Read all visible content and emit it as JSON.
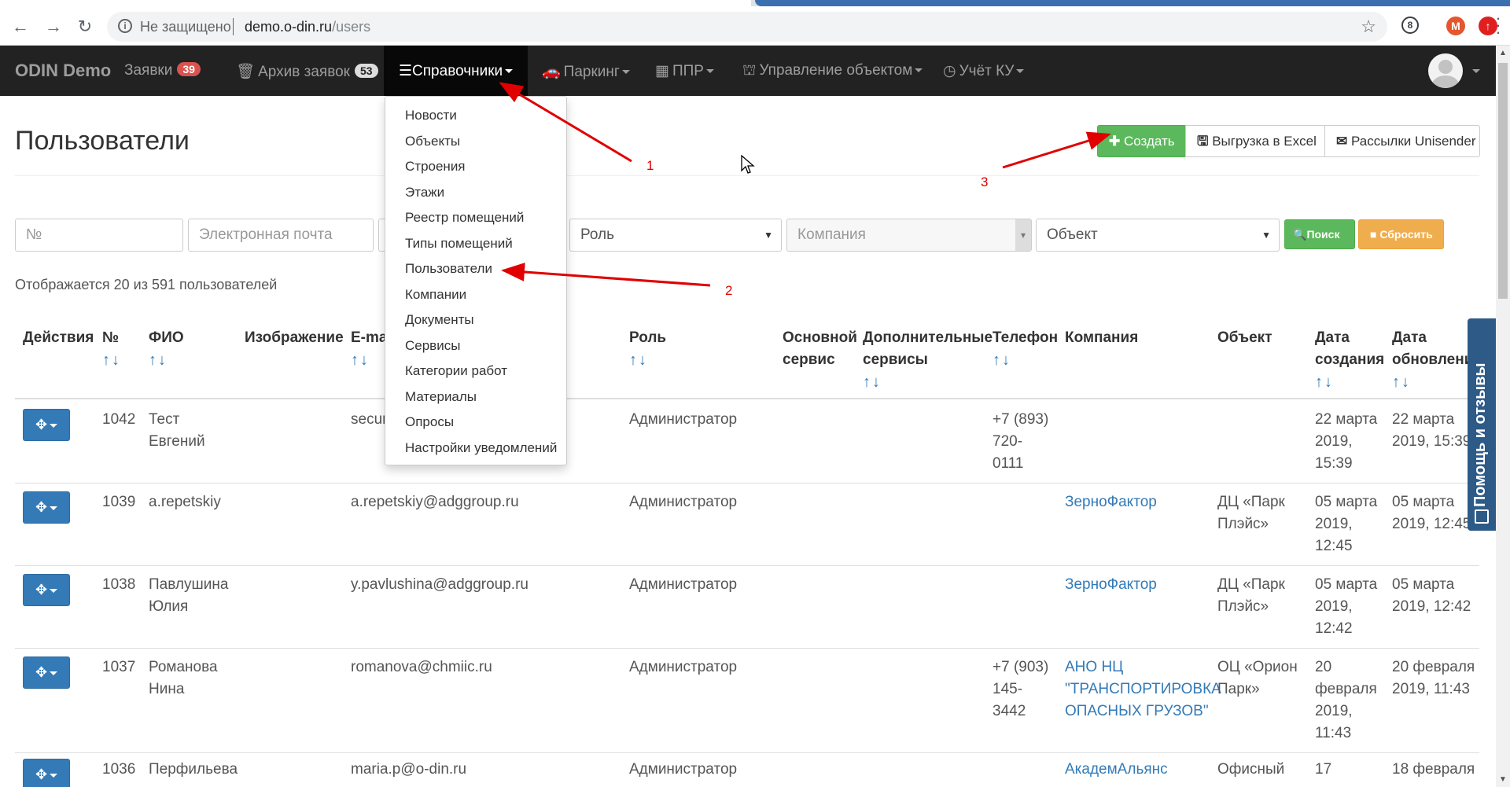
{
  "browser": {
    "security_label": "Не защищено",
    "url_host": "demo.o-din.ru",
    "url_path": "/users",
    "ext_m_label": "M"
  },
  "navbar": {
    "brand": "ODIN Demo",
    "requests_label": "Заявки",
    "requests_count": "39",
    "archive_label": "Архив заявок",
    "archive_count": "53",
    "directories_label": "Справочники",
    "parking_label": "Паркинг",
    "ppr_label": "ППР",
    "object_mgmt_label": "Управление объектом",
    "ku_label": "Учёт КУ"
  },
  "dropdown": {
    "items": [
      "Новости",
      "Объекты",
      "Строения",
      "Этажи",
      "Реестр помещений",
      "Типы помещений",
      "Пользователи",
      "Компании",
      "Документы",
      "Сервисы",
      "Категории работ",
      "Материалы",
      "Опросы",
      "Настройки уведомлений"
    ]
  },
  "page": {
    "title": "Пользователи",
    "create_label": "Создать",
    "excel_label": "Выгрузка в Excel",
    "unisender_label": "Рассылки Unisender",
    "count_text": "Отображается 20 из 591 пользователей"
  },
  "filters": {
    "number_placeholder": "№",
    "email_placeholder": "Электронная почта",
    "role_label": "Роль",
    "company_placeholder": "Компания",
    "object_label": "Объект",
    "search_label": "Поиск",
    "reset_label": "Сбросить"
  },
  "table": {
    "headers": {
      "actions": "Действия",
      "number": "№",
      "fio": "ФИО",
      "image": "Изображение",
      "email": "E-mail",
      "role": "Роль",
      "main_service_1": "Основной",
      "main_service_2": "сервис",
      "extra_services_1": "Дополнительные",
      "extra_services_2": "сервисы",
      "phone": "Телефон",
      "company": "Компания",
      "object": "Объект",
      "created_1": "Дата",
      "created_2": "создания",
      "updated_1": "Дата",
      "updated_2": "обновления",
      "sort_arrows": "↑↓"
    },
    "rows": [
      {
        "id": "1042",
        "fio": [
          "Тест",
          "Евгений"
        ],
        "email": "securi",
        "role": "Администратор",
        "phone": [
          "+7 (893)",
          "720-",
          "0111"
        ],
        "company": [],
        "object": [],
        "created": [
          "22 марта",
          "2019,",
          "15:39"
        ],
        "updated": [
          "22 марта",
          "2019, 15:39"
        ]
      },
      {
        "id": "1039",
        "fio": [
          "a.repetskiy"
        ],
        "email": "a.repetskiy@adggroup.ru",
        "role": "Администратор",
        "phone": [],
        "company": [
          "ЗерноФактор"
        ],
        "object": [
          "ДЦ «Парк",
          "Плэйс»"
        ],
        "created": [
          "05 марта",
          "2019,",
          "12:45"
        ],
        "updated": [
          "05 марта",
          "2019, 12:45"
        ]
      },
      {
        "id": "1038",
        "fio": [
          "Павлушина",
          "Юлия"
        ],
        "email": "y.pavlushina@adggroup.ru",
        "role": "Администратор",
        "phone": [],
        "company": [
          "ЗерноФактор"
        ],
        "object": [
          "ДЦ «Парк",
          "Плэйс»"
        ],
        "created": [
          "05 марта",
          "2019,",
          "12:42"
        ],
        "updated": [
          "05 марта",
          "2019, 12:42"
        ]
      },
      {
        "id": "1037",
        "fio": [
          "Романова",
          "Нина"
        ],
        "email": "romanova@chmiic.ru",
        "role": "Администратор",
        "phone": [
          "+7 (903)",
          "145-",
          "3442"
        ],
        "company": [
          "АНО НЦ",
          "\"ТРАНСПОРТИРОВКА",
          "ОПАСНЫХ ГРУЗОВ\""
        ],
        "object": [
          "ОЦ «Орион",
          "Парк»"
        ],
        "created": [
          "20",
          "февраля",
          "2019,",
          "11:43"
        ],
        "updated": [
          "20 февраля",
          "2019, 11:43"
        ]
      },
      {
        "id": "1036",
        "fio": [
          "Перфильева"
        ],
        "email": "maria.p@o-din.ru",
        "role": "Администратор",
        "phone": [],
        "company": [
          "АкадемАльянс"
        ],
        "object": [
          "Офисный"
        ],
        "created": [
          "17"
        ],
        "updated": [
          "18 февраля"
        ]
      }
    ]
  },
  "help_tab": {
    "label": "Помощь и отзывы"
  },
  "annotations": {
    "n1": "1",
    "n2": "2",
    "n3": "3"
  },
  "colors": {
    "navbar": "#222222",
    "primary": "#337ab7",
    "success": "#5cb85c",
    "warning": "#f0ad4e",
    "danger": "#d9534f",
    "annotation": "#e00000"
  }
}
